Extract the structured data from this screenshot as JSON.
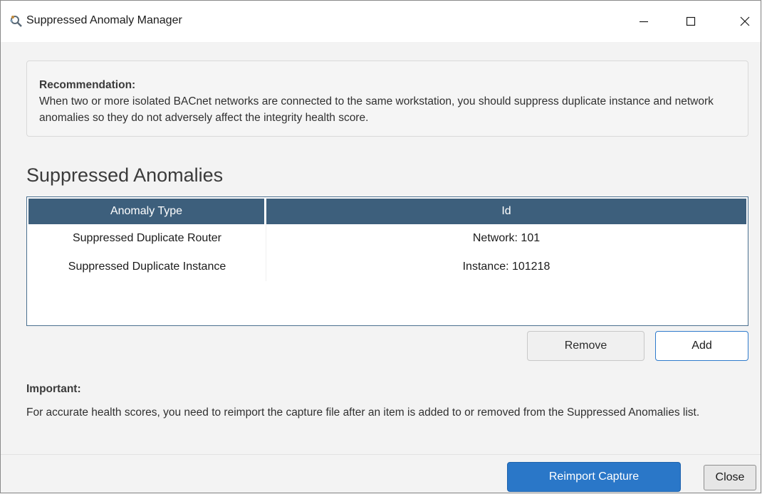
{
  "window": {
    "title": "Suppressed Anomaly Manager",
    "icon": "app-logo-icon",
    "controls": [
      "minimize-icon",
      "maximize-icon",
      "close-icon"
    ]
  },
  "recommendation": {
    "heading": "Recommendation:",
    "text": "When two or more isolated BACnet networks are connected to the same workstation, you should suppress duplicate instance and network anomalies so they do not adversely affect the integrity health score."
  },
  "section": {
    "title": "Suppressed Anomalies"
  },
  "table": {
    "columns": [
      "Anomaly Type",
      "Id"
    ],
    "rows": [
      {
        "type": "Suppressed Duplicate Router",
        "id": "Network: 101"
      },
      {
        "type": "Suppressed Duplicate Instance",
        "id": "Instance: 101218"
      }
    ]
  },
  "actions": {
    "remove_label": "Remove",
    "add_label": "Add"
  },
  "important": {
    "heading": "Important:",
    "text": "For accurate health scores, you need to reimport the capture file after an item is added to or removed from the Suppressed Anomalies list."
  },
  "footer": {
    "reimport_label": "Reimport Capture",
    "close_label": "Close"
  },
  "colors": {
    "header_bg": "#3d5f7c",
    "primary_button": "#2a77c8",
    "add_border": "#2f7bcc"
  }
}
